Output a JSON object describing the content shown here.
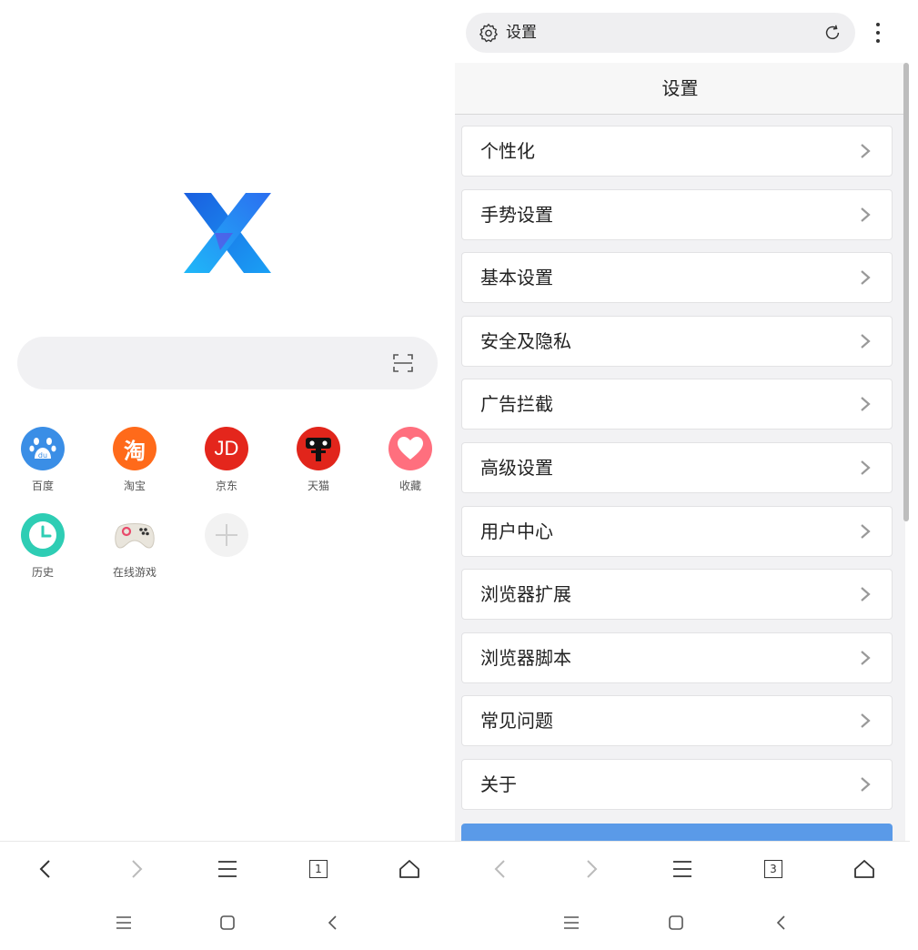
{
  "left": {
    "shortcuts": [
      {
        "label": "百度",
        "icon": "baidu-icon",
        "color": "#3a8ee6"
      },
      {
        "label": "淘宝",
        "icon": "taobao-icon",
        "color": "#ff6a1a",
        "glyph": "淘"
      },
      {
        "label": "京东",
        "icon": "jd-icon",
        "color": "#e4261c",
        "glyph": "JD"
      },
      {
        "label": "天猫",
        "icon": "tmall-icon",
        "color": "#e1251b"
      },
      {
        "label": "收藏",
        "icon": "heart-icon",
        "color": "#ff6f7e"
      },
      {
        "label": "历史",
        "icon": "clock-icon",
        "color": "#2ecdb4"
      },
      {
        "label": "在线游戏",
        "icon": "gamepad-icon",
        "color": "#ffffff"
      }
    ],
    "toolbar": {
      "tab_count": "1"
    }
  },
  "right": {
    "address_bar": {
      "text": "设置"
    },
    "settings": {
      "title": "设置",
      "items": [
        "个性化",
        "手势设置",
        "基本设置",
        "安全及隐私",
        "广告拦截",
        "高级设置",
        "用户中心",
        "浏览器扩展",
        "浏览器脚本",
        "常见问题",
        "关于"
      ]
    },
    "toolbar": {
      "tab_count": "3"
    }
  },
  "colors": {
    "accent_blue": "#5a9ae8",
    "logo_blue": "#1e7cf0"
  }
}
